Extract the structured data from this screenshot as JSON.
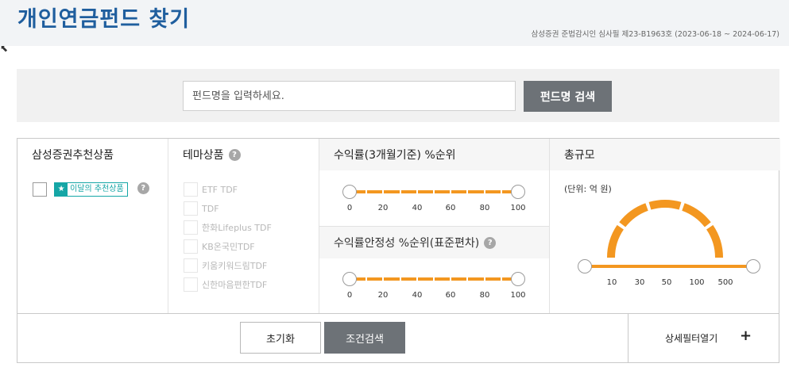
{
  "header": {
    "title": "개인연금펀드 찾기",
    "compliance": "삼성증권 준법감시인 심사필 제23-B1963호 (2023-06-18 ~ 2024-06-17)"
  },
  "search": {
    "placeholder": "펀드명을 입력하세요.",
    "button_label": "펀드명 검색"
  },
  "filters": {
    "recommend": {
      "heading": "삼성증권추천상품",
      "badge_label": "이달의 추천상품",
      "badge_icon": "star-icon",
      "checked": false
    },
    "theme": {
      "heading": "테마상품",
      "items": [
        {
          "label": "ETF TDF"
        },
        {
          "label": "TDF"
        },
        {
          "label": "한화Lifeplus TDF"
        },
        {
          "label": "KB온국민TDF"
        },
        {
          "label": "키움키워드림TDF"
        },
        {
          "label": "신한마음편한TDF"
        }
      ]
    },
    "return_rank": {
      "heading": "수익률(3개월기준) %순위",
      "ticks": [
        "0",
        "20",
        "40",
        "60",
        "80",
        "100"
      ],
      "range": [
        0,
        100
      ]
    },
    "stability_rank": {
      "heading": "수익률안정성 %순위(표준편차)",
      "ticks": [
        "0",
        "20",
        "40",
        "60",
        "80",
        "100"
      ],
      "range": [
        0,
        100
      ]
    },
    "total_size": {
      "heading": "총규모",
      "unit": "(단위: 억 원)",
      "ticks": [
        "10",
        "30",
        "50",
        "100",
        "500"
      ],
      "range_index": [
        0,
        5
      ]
    }
  },
  "actions": {
    "reset_label": "초기화",
    "search_label": "조건검색",
    "more_filter_label": "상세필터열기",
    "more_filter_icon": "+"
  },
  "colors": {
    "title": "#1f5e9e",
    "accent": "#f39720",
    "badge": "#15a6a6",
    "button_dark": "#6d7277"
  }
}
